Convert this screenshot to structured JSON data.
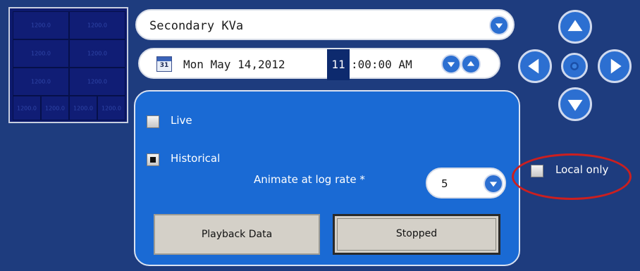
{
  "minimap": {
    "rows": [
      [
        "1200.0",
        "1200.0"
      ],
      [
        "1200.0",
        "1200.0"
      ],
      [
        "1200.0",
        "1200.0"
      ]
    ],
    "bottom_row": [
      "1200.0",
      "1200.0",
      "1200.0",
      "1200.0"
    ]
  },
  "measure": {
    "selected": "Secondary KVa",
    "dropdown_icon": "chevron-down-icon"
  },
  "datetime": {
    "calendar_day": "31",
    "date": "Mon May 14,2012",
    "hour": "11",
    "rest": ":00:00 AM",
    "down_icon": "chevron-down-icon",
    "up_icon": "chevron-up-icon"
  },
  "playback": {
    "live_label": "Live",
    "live_checked": false,
    "historical_label": "Historical",
    "historical_checked": true,
    "animate_label": "Animate at log rate *",
    "rate_value": "5",
    "playback_button": "Playback Data",
    "status_button": "Stopped"
  },
  "navigation": {
    "up": "arrow-up-icon",
    "down": "arrow-down-icon",
    "left": "arrow-left-icon",
    "right": "arrow-right-icon",
    "center": "center-dot-icon"
  },
  "local_only": {
    "label": "Local only",
    "checked": false,
    "highlight_color": "#cc1f1f"
  },
  "colors": {
    "background": "#1e3c7e",
    "panel": "#1a6ad4",
    "button_blue": "#2c6fd1"
  }
}
